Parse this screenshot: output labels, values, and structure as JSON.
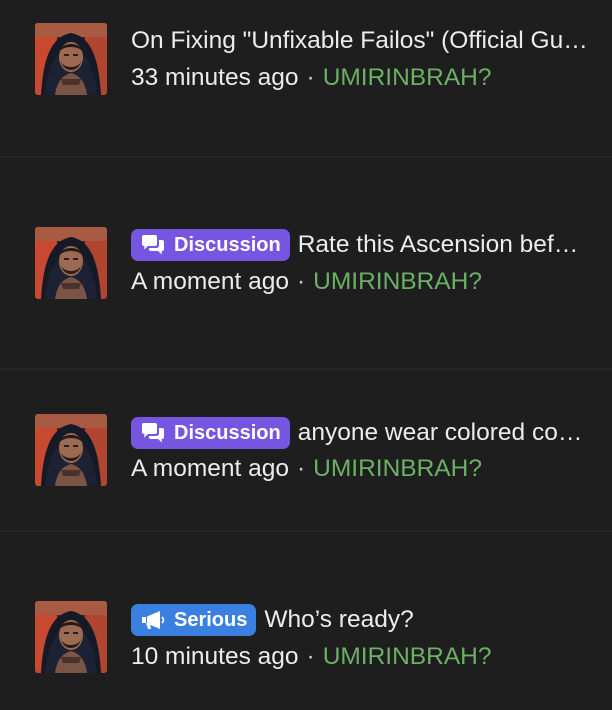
{
  "colors": {
    "background": "#1e1e1f",
    "divider": "#262627",
    "text": "#ececec",
    "username": "#6bb063",
    "discussion_badge": "#7656e0",
    "serious_badge": "#3b7fe0"
  },
  "threads": [
    {
      "badge": null,
      "title": "On Fixing \"Unfixable Failos\" (Official Guide)",
      "time": "33 minutes ago",
      "separator": "·",
      "user": "UMIRINBRAH?"
    },
    {
      "badge": {
        "label": "Discussion",
        "icon": "speech-bubbles-icon"
      },
      "title": "Rate this Ascension before and after",
      "time": "A moment ago",
      "separator": "·",
      "user": "UMIRINBRAH?"
    },
    {
      "badge": {
        "label": "Discussion",
        "icon": "speech-bubbles-icon"
      },
      "title": "anyone wear colored contacts here?",
      "time": "A moment ago",
      "separator": "·",
      "user": "UMIRINBRAH?"
    },
    {
      "badge": {
        "label": "Serious",
        "icon": "megaphone-icon"
      },
      "title": "Who’s ready?",
      "time": "10 minutes ago",
      "separator": "·",
      "user": "UMIRINBRAH?"
    }
  ]
}
